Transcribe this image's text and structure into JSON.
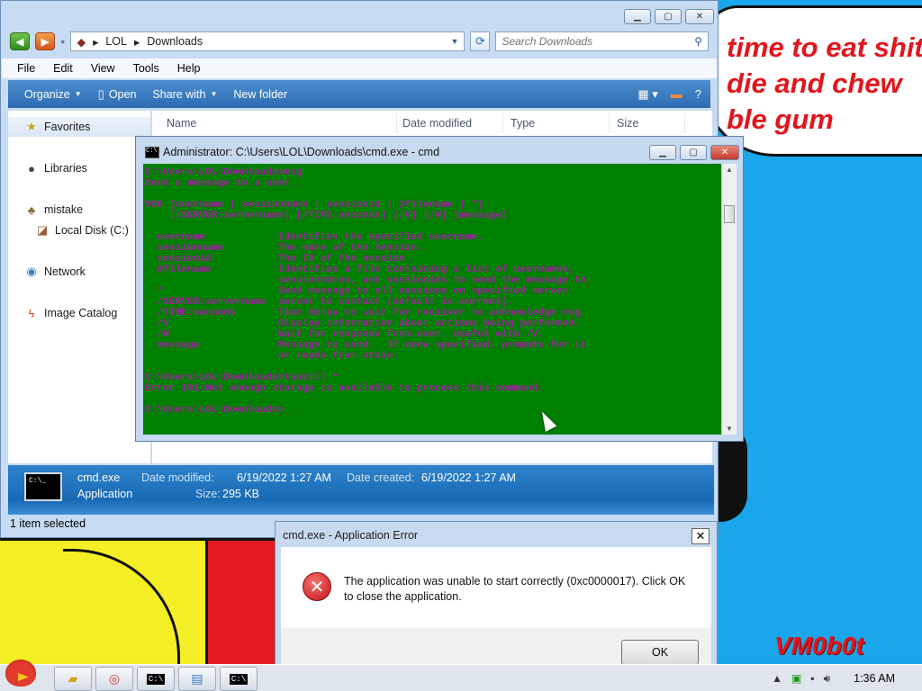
{
  "desktop": {
    "speech_lines": [
      "time to eat shit",
      "die and chew",
      "ble gum"
    ],
    "watermark": "VM0b0t",
    "accent_red": "#e2151d"
  },
  "explorer": {
    "breadcrumb": [
      "LOL",
      "Downloads"
    ],
    "search_placeholder": "Search Downloads",
    "menu": [
      "File",
      "Edit",
      "View",
      "Tools",
      "Help"
    ],
    "commands": {
      "organize": "Organize",
      "open": "Open",
      "share": "Share with",
      "new_folder": "New folder"
    },
    "nav": {
      "favorites": "Favorites",
      "libraries": "Libraries",
      "mistake": "mistake",
      "local_disk": "Local Disk (C:)",
      "network": "Network",
      "image_catalog": "Image Catalog"
    },
    "columns": [
      "Name",
      "Date modified",
      "Type",
      "Size"
    ],
    "details": {
      "name": "cmd.exe",
      "type": "Application",
      "modified_label": "Date modified:",
      "modified": "6/19/2022 1:27 AM",
      "created_label": "Date created:",
      "created": "6/19/2022 1:27 AM",
      "size_label": "Size:",
      "size": "295 KB"
    },
    "status": "1 item selected"
  },
  "cmd": {
    "title": "Administrator: C:\\Users\\LOL\\Downloads\\cmd.exe - cmd",
    "lines": [
      "C:\\Users\\LOL\\Downloads>msg",
      "Send a message to a user.",
      "",
      "MSG {username | sessionname | sessionid | @filename | *}",
      "    [/SERVER:servername] [/TIME:seconds] [/V] [/W] [message]",
      "",
      "  username            Identifies the specified username.",
      "  sessionname         The name of the session.",
      "  sessionid           The ID of the session.",
      "  @filename           Identifies a file containing a list of usernames,",
      "                      sessionnames, and sessionids to send the message to.",
      "  *                   Send message to all sessions on specified server.",
      "  /SERVER:servername  server to contact (default is current).",
      "  /TIME:seconds       Time delay to wait for receiver to acknowledge msg.",
      "  /V                  Display information about actions being performed.",
      "  /W                  Wait for response from user, useful with /V.",
      "  message             Message to send.  If none specified, prompts for it",
      "                      or reads from stdin.",
      "",
      "C:\\Users\\LOL\\Downloads>taskill *",
      "Error 191:Not enough storage is available to process this command.",
      "",
      "C:\\Users\\LOL\\Downloads>_"
    ]
  },
  "dialog": {
    "title": "cmd.exe - Application Error",
    "message": "The application was unable to start correctly (0xc0000017). Click OK to close the application.",
    "ok": "OK"
  },
  "taskbar": {
    "buttons": [
      "folder-icon",
      "chrome-icon",
      "cmd-icon",
      "notepad-icon",
      "cmd-icon"
    ],
    "clock": "1:36 AM"
  }
}
